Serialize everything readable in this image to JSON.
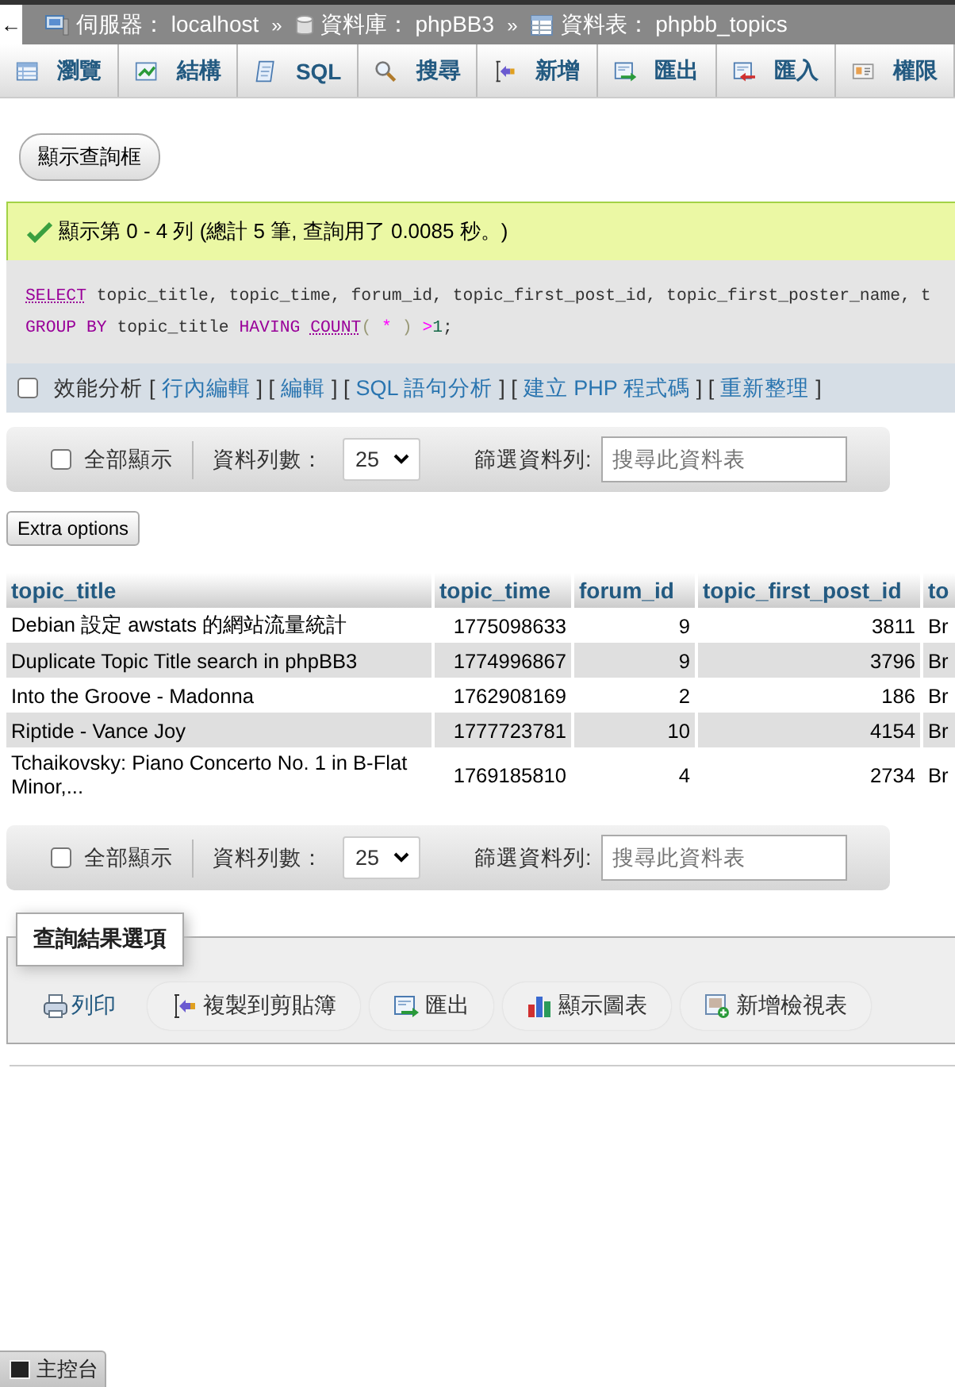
{
  "breadcrumb": {
    "back": "←",
    "parts": [
      {
        "kind": "server",
        "text": "伺服器： localhost"
      },
      {
        "kind": "separator",
        "text": "»"
      },
      {
        "kind": "database",
        "text": "資料庫： phpBB3"
      },
      {
        "kind": "separator",
        "text": "»"
      },
      {
        "kind": "table",
        "text": "資料表： phpbb_topics"
      }
    ]
  },
  "tabs": [
    {
      "label": "瀏覽",
      "selected": false
    },
    {
      "label": "結構",
      "selected": false
    },
    {
      "label": "SQL",
      "selected": false
    },
    {
      "label": "搜尋",
      "selected": false
    },
    {
      "label": "新增",
      "selected": false
    },
    {
      "label": "匯出",
      "selected": false
    },
    {
      "label": "匯入",
      "selected": false
    },
    {
      "label": "權限",
      "selected": false
    }
  ],
  "show_query_button": "顯示查詢框",
  "message": {
    "kind": "success",
    "text": "顯示第 0 - 4 列 (總計 5 筆, 查詢用了 0.0085 秒。)"
  },
  "sql": {
    "lines": [
      [
        {
          "kind": "keyword",
          "text": "SELECT"
        },
        {
          "kind": "plain",
          "text": " topic_title, topic_time, forum_id, topic_first_post_id, topic_first_poster_name, t"
        }
      ],
      [
        {
          "kind": "keyword",
          "text": "GROUP BY"
        },
        {
          "kind": "plain",
          "text": " topic_title "
        },
        {
          "kind": "keyword",
          "text": "HAVING "
        },
        {
          "kind": "function",
          "text": "COUNT"
        },
        {
          "kind": "paren",
          "text": "( "
        },
        {
          "kind": "operator",
          "text": "*"
        },
        {
          "kind": "paren",
          "text": " ) "
        },
        {
          "kind": "operator",
          "text": ">"
        },
        {
          "kind": "number",
          "text": "1"
        },
        {
          "kind": "plain",
          "text": ";"
        }
      ]
    ]
  },
  "profiling": {
    "label": "效能分析",
    "checked": false,
    "parts": [
      {
        "kind": "text",
        "text": "["
      },
      {
        "kind": "link",
        "text": "行內編輯"
      },
      {
        "kind": "text",
        "text": "] ["
      },
      {
        "kind": "link",
        "text": "編輯"
      },
      {
        "kind": "text",
        "text": "] ["
      },
      {
        "kind": "link",
        "text": "SQL 語句分析"
      },
      {
        "kind": "text",
        "text": "] ["
      },
      {
        "kind": "link",
        "text": "建立 PHP 程式碼"
      },
      {
        "kind": "text",
        "text": "] ["
      },
      {
        "kind": "link",
        "text": "重新整理"
      },
      {
        "kind": "text",
        "text": "]"
      }
    ]
  },
  "top_navbar": {
    "show_all": {
      "label": "全部顯示",
      "checked": false
    },
    "rows_label": "資料列數：",
    "rows_value": "25",
    "filter_label": "篩選資料列:",
    "filter_placeholder": "搜尋此資料表"
  },
  "extra_options_button": "Extra options",
  "table": {
    "columns": [
      {
        "label": "topic_title",
        "kind": "text"
      },
      {
        "label": "topic_time",
        "kind": "number"
      },
      {
        "label": "forum_id",
        "kind": "number"
      },
      {
        "label": "topic_first_post_id",
        "kind": "number"
      },
      {
        "label": "to",
        "kind": "text"
      }
    ],
    "rows": [
      [
        "Debian 設定 awstats 的網站流量統計",
        "1775098633",
        "9",
        "3811",
        "Br"
      ],
      [
        "Duplicate Topic Title search in phpBB3",
        "1774996867",
        "9",
        "3796",
        "Br"
      ],
      [
        "Into the Groove - Madonna",
        "1762908169",
        "2",
        "186",
        "Br"
      ],
      [
        "Riptide - Vance Joy",
        "1777723781",
        "10",
        "4154",
        "Br"
      ],
      [
        "Tchaikovsky: Piano Concerto No. 1 in B-Flat Minor,...",
        "1769185810",
        "4",
        "2734",
        "Br"
      ]
    ]
  },
  "bottom_navbar": {
    "show_all": {
      "label": "全部顯示",
      "checked": false
    },
    "rows_label": "資料列數：",
    "rows_value": "25",
    "filter_label": "篩選資料列:",
    "filter_placeholder": "搜尋此資料表"
  },
  "result_options": {
    "legend": "查詢結果選項",
    "actions": [
      {
        "kind": "link",
        "label": "列印"
      },
      {
        "kind": "pill",
        "label": "複製到剪貼簿"
      },
      {
        "kind": "pill",
        "label": "匯出"
      },
      {
        "kind": "pill",
        "label": "顯示圖表"
      },
      {
        "kind": "pill",
        "label": "新增檢視表"
      }
    ]
  },
  "console": {
    "label": "主控台"
  }
}
